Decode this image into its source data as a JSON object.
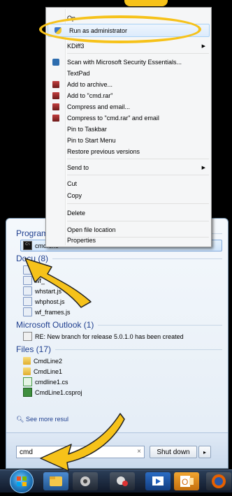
{
  "context_menu": {
    "items": [
      {
        "label": "Op",
        "icon": null,
        "submenu": false
      },
      {
        "label": "Run as administrator",
        "icon": "uac-shield-icon",
        "submenu": false,
        "highlighted": true
      },
      {
        "label": "KDiff3",
        "icon": null,
        "submenu": true
      },
      {
        "label": "Scan with Microsoft Security Essentials...",
        "icon": "security-essentials-icon",
        "submenu": false
      },
      {
        "label": "TextPad",
        "icon": null,
        "submenu": false
      },
      {
        "label": "Add to archive...",
        "icon": "winrar-icon",
        "submenu": false
      },
      {
        "label": "Add to \"cmd.rar\"",
        "icon": "winrar-icon",
        "submenu": false
      },
      {
        "label": "Compress and email...",
        "icon": "winrar-icon",
        "submenu": false
      },
      {
        "label": "Compress to \"cmd.rar\" and email",
        "icon": "winrar-icon",
        "submenu": false
      },
      {
        "label": "Pin to Taskbar",
        "icon": null,
        "submenu": false
      },
      {
        "label": "Pin to Start Menu",
        "icon": null,
        "submenu": false
      },
      {
        "label": "Restore previous versions",
        "icon": null,
        "submenu": false
      },
      {
        "label": "Send to",
        "icon": null,
        "submenu": true
      },
      {
        "label": "Cut",
        "icon": null,
        "submenu": false
      },
      {
        "label": "Copy",
        "icon": null,
        "submenu": false
      },
      {
        "label": "Delete",
        "icon": null,
        "submenu": false
      },
      {
        "label": "Open file location",
        "icon": null,
        "submenu": false
      },
      {
        "label": "Properties",
        "icon": null,
        "submenu": false
      }
    ]
  },
  "start_menu": {
    "programs_header": "Program",
    "programs": [
      {
        "label": "cmd.exe",
        "icon": "command-prompt-icon",
        "selected": true
      }
    ],
    "documents_header": "Docu",
    "documents_count": "(8)",
    "documents": [
      {
        "label": "wh",
        "icon": "script-file-icon"
      },
      {
        "label": "wf_",
        "icon": "script-file-icon"
      },
      {
        "label": "whstart.js",
        "icon": "script-file-icon"
      },
      {
        "label": "whphost.js",
        "icon": "script-file-icon"
      },
      {
        "label": "wf_frames.js",
        "icon": "script-file-icon"
      }
    ],
    "outlook_header": "Microsoft Outlook (1)",
    "outlook": [
      {
        "label": "RE: New branch for release 5.0.1.0 has been created",
        "icon": "mail-icon"
      }
    ],
    "files_header": "Files (17)",
    "files": [
      {
        "label": "CmdLine2",
        "icon": "folder-icon"
      },
      {
        "label": "CmdLine1",
        "icon": "folder-icon"
      },
      {
        "label": "cmdline1.cs",
        "icon": "csharp-file-icon"
      },
      {
        "label": "CmdLine1.csproj",
        "icon": "csproj-file-icon"
      }
    ],
    "see_more": "See more resul",
    "search_value": "cmd",
    "search_clear": "×",
    "shutdown_label": "Shut down",
    "shutdown_arrow": "▸"
  },
  "taskbar": {
    "items": [
      "start-orb",
      "explorer-icon",
      "media-icon",
      "paint-icon",
      "remote-desktop-icon",
      "outlook-icon",
      "firefox-icon"
    ]
  },
  "colors": {
    "annotation": "#f6c21a",
    "header_text": "#1f3f8f",
    "highlight_border": "#84acdd"
  }
}
